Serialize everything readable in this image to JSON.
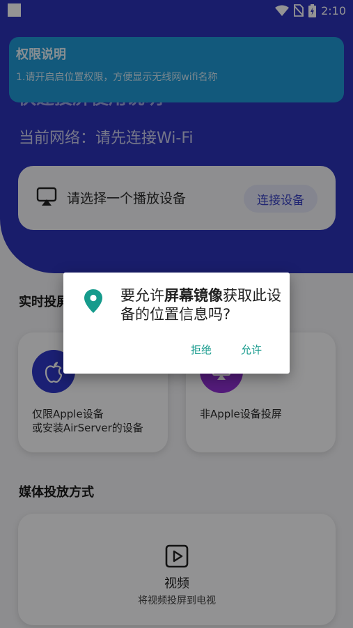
{
  "status_bar": {
    "time": "2:10"
  },
  "header": {
    "obscured_title": "快速投屏使用说明",
    "network_label": "当前网络：请先连接Wi-Fi",
    "device_select": {
      "label": "请选择一个播放设备",
      "connect_button": "连接设备"
    }
  },
  "permission_notice": {
    "title": "权限说明",
    "description": "1.请开启启位置权限，方便显示无线网wifi名称"
  },
  "realtime_section": {
    "title": "实时投屏",
    "cards": [
      {
        "line1": "仅限Apple设备",
        "line2": "或安装AirServer的设备"
      },
      {
        "line1": "非Apple设备投屏"
      }
    ]
  },
  "media_section": {
    "title": "媒体投放方式",
    "video": {
      "title": "视频",
      "subtitle": "将视频投屏到电视"
    }
  },
  "dialog": {
    "message_pre": "要允许",
    "app_name": "屏幕镜像",
    "message_post": "获取此设备的位置信息吗?",
    "deny_label": "拒绝",
    "allow_label": "允许"
  },
  "colors": {
    "header_blue": "#2c32b8",
    "notice_blue": "#1f9ad6",
    "dialog_accent": "#159a8c",
    "apple_circle": "#2f37c8",
    "purple_circle": "#8f2fd3"
  }
}
